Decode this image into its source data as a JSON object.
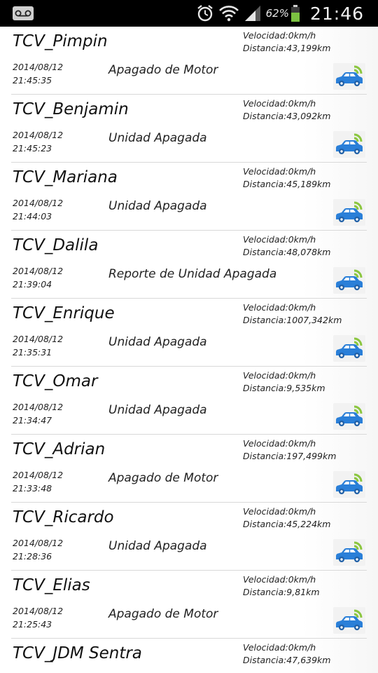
{
  "status_bar": {
    "battery_pct": "62%",
    "clock": "21:46",
    "icons": [
      "voicemail-icon",
      "alarm-icon",
      "wifi-icon",
      "signal-icon",
      "battery-icon"
    ]
  },
  "units": {
    "speed_label": "Velocidad:",
    "distance_label": "Distancia:"
  },
  "colors": {
    "car": "#2a7fd8",
    "signal": "#8bc63f",
    "divider": "#d9d9d9"
  },
  "vehicles": [
    {
      "name": "TCV_Pimpin",
      "speed": "Velocidad:0km/h",
      "distance": "Distancia:43,199km",
      "date": "2014/08/12",
      "time": "21:45:35",
      "status": "Apagado de Motor"
    },
    {
      "name": "TCV_Benjamin",
      "speed": "Velocidad:0km/h",
      "distance": "Distancia:43,092km",
      "date": "2014/08/12",
      "time": "21:45:23",
      "status": "Unidad Apagada"
    },
    {
      "name": "TCV_Mariana",
      "speed": "Velocidad:0km/h",
      "distance": "Distancia:45,189km",
      "date": "2014/08/12",
      "time": "21:44:03",
      "status": "Unidad Apagada"
    },
    {
      "name": "TCV_Dalila",
      "speed": "Velocidad:0km/h",
      "distance": "Distancia:48,078km",
      "date": "2014/08/12",
      "time": "21:39:04",
      "status": "Reporte de Unidad Apagada"
    },
    {
      "name": "TCV_Enrique",
      "speed": "Velocidad:0km/h",
      "distance": "Distancia:1007,342km",
      "date": "2014/08/12",
      "time": "21:35:31",
      "status": "Unidad Apagada"
    },
    {
      "name": "TCV_Omar",
      "speed": "Velocidad:0km/h",
      "distance": "Distancia:9,535km",
      "date": "2014/08/12",
      "time": "21:34:47",
      "status": "Unidad Apagada"
    },
    {
      "name": "TCV_Adrian",
      "speed": "Velocidad:0km/h",
      "distance": "Distancia:197,499km",
      "date": "2014/08/12",
      "time": "21:33:48",
      "status": "Apagado de Motor"
    },
    {
      "name": "TCV_Ricardo",
      "speed": "Velocidad:0km/h",
      "distance": "Distancia:45,224km",
      "date": "2014/08/12",
      "time": "21:28:36",
      "status": "Unidad Apagada"
    },
    {
      "name": "TCV_Elias",
      "speed": "Velocidad:0km/h",
      "distance": "Distancia:9,81km",
      "date": "2014/08/12",
      "time": "21:25:43",
      "status": "Apagado de Motor"
    },
    {
      "name": "TCV_JDM Sentra",
      "speed": "Velocidad:0km/h",
      "distance": "Distancia:47,639km",
      "date": "",
      "time": "",
      "status": ""
    }
  ]
}
